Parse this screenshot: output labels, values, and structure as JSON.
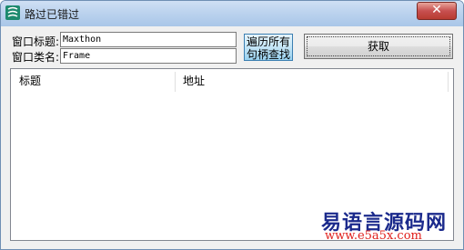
{
  "window": {
    "title": "路过已错过",
    "close_glyph": "✕"
  },
  "form": {
    "window_title_label": "窗口标题:",
    "window_title_value": "Maxthon",
    "window_class_label": "窗口类名:",
    "window_class_value": "Frame",
    "enum_button_line1": "遍历所有",
    "enum_button_line2": "句柄查找",
    "get_button": "获取"
  },
  "list": {
    "columns": [
      "标题",
      "地址"
    ],
    "rows": []
  },
  "watermark": {
    "name": "易语言源码网",
    "url": "www.e5a5x.com"
  },
  "icons": {
    "app": "app-icon",
    "close": "close-icon"
  }
}
